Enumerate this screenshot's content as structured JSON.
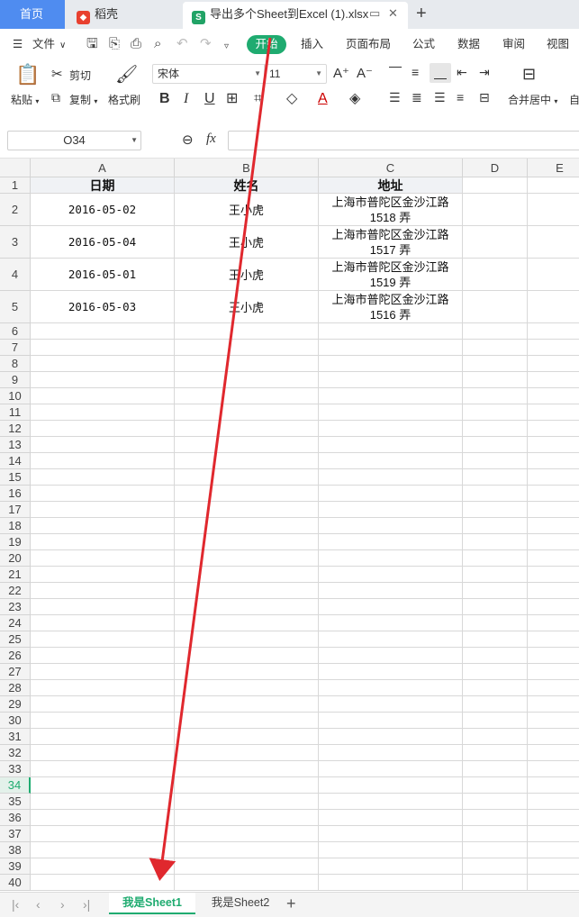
{
  "tabs": {
    "home": "首页",
    "daoke": "稻壳",
    "active_file": "导出多个Sheet到Excel (1).xlsx",
    "icon_s": "S"
  },
  "menu": {
    "file": "文件",
    "items": [
      "开始",
      "插入",
      "页面布局",
      "公式",
      "数据",
      "审阅",
      "视图"
    ]
  },
  "ribbon": {
    "paste": "粘贴",
    "cut": "剪切",
    "copy": "复制",
    "format_painter": "格式刷",
    "font_name": "宋体",
    "font_size": "11",
    "merge_center": "合并居中",
    "auto": "自"
  },
  "formula_bar": {
    "name_box": "O34",
    "fx": "fx",
    "content": ""
  },
  "columns": [
    "A",
    "B",
    "C",
    "D",
    "E"
  ],
  "headers": [
    "日期",
    "姓名",
    "地址"
  ],
  "rows": [
    {
      "date": "2016-05-02",
      "name": "王小虎",
      "address": "上海市普陀区金沙江路 1518 弄"
    },
    {
      "date": "2016-05-04",
      "name": "王小虎",
      "address": "上海市普陀区金沙江路 1517 弄"
    },
    {
      "date": "2016-05-01",
      "name": "王小虎",
      "address": "上海市普陀区金沙江路 1519 弄"
    },
    {
      "date": "2016-05-03",
      "name": "王小虎",
      "address": "上海市普陀区金沙江路 1516 弄"
    }
  ],
  "row_numbers": [
    "1",
    "2",
    "3",
    "4",
    "5",
    "6",
    "7",
    "8",
    "9",
    "10",
    "11",
    "12",
    "13",
    "14",
    "15",
    "16",
    "17",
    "18",
    "19",
    "20",
    "21",
    "22",
    "23",
    "24",
    "25",
    "26",
    "27",
    "28",
    "29",
    "30",
    "31",
    "32",
    "33",
    "34",
    "35",
    "36",
    "37",
    "38",
    "39",
    "40"
  ],
  "selected_row": "34",
  "sheets": [
    "我是Sheet1",
    "我是Sheet2"
  ],
  "colors": {
    "accent": "#1fab70",
    "home_tab": "#4f8cf0",
    "arrow": "#e0282e"
  }
}
